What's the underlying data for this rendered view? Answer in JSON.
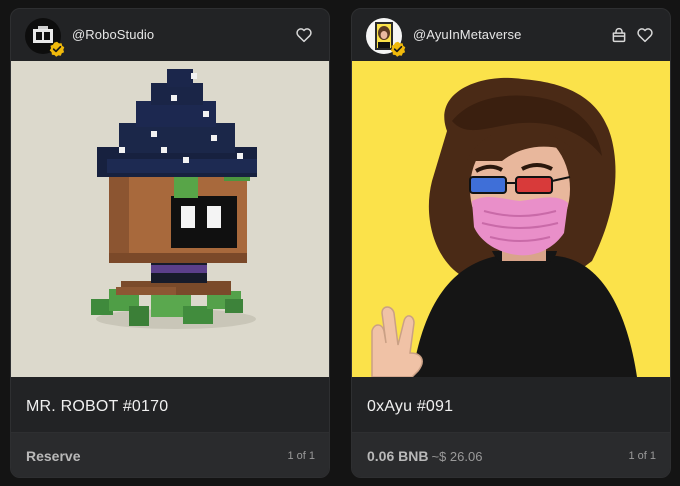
{
  "cards": [
    {
      "creator": "@RoboStudio",
      "title": "MR. ROBOT #0170",
      "status": "Reserve",
      "edition": "1 of 1",
      "art_bg": "#dcd9cc"
    },
    {
      "creator": "@AyuInMetaverse",
      "title": "0xAyu #091",
      "price": "0.06 BNB",
      "price_usd": "~$ 26.06",
      "edition": "1 of 1",
      "art_bg": "#fbe24a"
    }
  ],
  "icons": [
    "verified-badge-icon",
    "heart-icon",
    "shopping-bag-icon"
  ],
  "colors": {
    "background": "#141414",
    "card": "#222325",
    "footer": "#2a2b2d",
    "verified": "#f0b90b"
  }
}
